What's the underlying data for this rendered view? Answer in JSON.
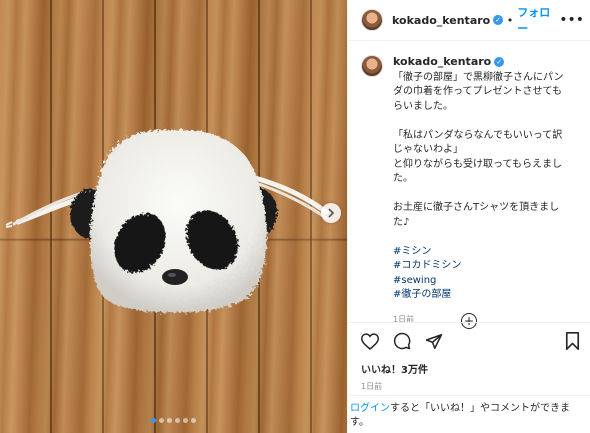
{
  "post": {
    "username": "kokado_kentaro",
    "separator": "•",
    "follow_label": "フォロー",
    "more_label": "•••",
    "caption_lines": [
      "「徹子の部屋」で黒柳徹子さんにパン",
      "ダの巾着を作ってプレゼントさせても",
      "らいました。",
      "",
      "「私はパンダならなんでもいいって訳",
      "じゃないわよ」",
      "と仰りながらも受け取ってもらえまし",
      "た。",
      "",
      "お土産に徹子さんTシャツを頂きまし",
      "た♪"
    ],
    "hashtags": [
      "#ミシン",
      "#コカドミシン",
      "#sewing",
      "#徹子の部屋"
    ],
    "caption_time": "1日前",
    "likes": "いいね！3万件",
    "post_time": "1日前",
    "login_link": "ログイン",
    "login_text": "すると「いいね！」やコメントができま",
    "login_text2": "す。",
    "carousel_count": 6,
    "carousel_active": 1
  },
  "icons": {
    "heart": "heart-icon",
    "comment": "comment-icon",
    "share": "share-icon",
    "save": "bookmark-icon",
    "add": "plus-circle-icon",
    "next": "chevron-right-icon",
    "verified": "verified-badge-icon"
  },
  "colors": {
    "accent": "#0095f6",
    "hashtag": "#00376b",
    "muted": "#8e8e8e",
    "carousel_active": "#3897f0"
  }
}
